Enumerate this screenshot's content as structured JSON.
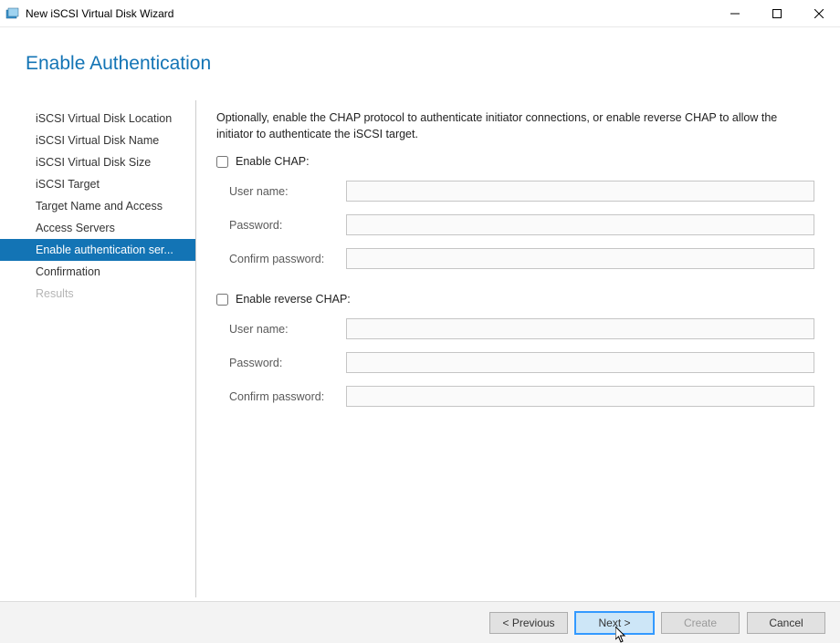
{
  "window": {
    "title": "New iSCSI Virtual Disk Wizard"
  },
  "heading": "Enable Authentication",
  "sidebar": {
    "steps": [
      {
        "label": "iSCSI Virtual Disk Location",
        "state": "normal"
      },
      {
        "label": "iSCSI Virtual Disk Name",
        "state": "normal"
      },
      {
        "label": "iSCSI Virtual Disk Size",
        "state": "normal"
      },
      {
        "label": "iSCSI Target",
        "state": "normal"
      },
      {
        "label": "Target Name and Access",
        "state": "normal"
      },
      {
        "label": "Access Servers",
        "state": "normal"
      },
      {
        "label": "Enable authentication ser...",
        "state": "selected"
      },
      {
        "label": "Confirmation",
        "state": "normal"
      },
      {
        "label": "Results",
        "state": "disabled"
      }
    ]
  },
  "main": {
    "intro": "Optionally, enable the CHAP protocol to authenticate initiator connections, or enable reverse CHAP to allow the initiator to authenticate the iSCSI target.",
    "chap": {
      "enable_label": "Enable CHAP:",
      "enabled": false,
      "username_label": "User name:",
      "username_value": "",
      "password_label": "Password:",
      "password_value": "",
      "confirm_label": "Confirm password:",
      "confirm_value": ""
    },
    "reverse_chap": {
      "enable_label": "Enable reverse CHAP:",
      "enabled": false,
      "username_label": "User name:",
      "username_value": "",
      "password_label": "Password:",
      "password_value": "",
      "confirm_label": "Confirm password:",
      "confirm_value": ""
    }
  },
  "footer": {
    "previous": "< Previous",
    "next": "Next >",
    "create": "Create",
    "cancel": "Cancel"
  }
}
